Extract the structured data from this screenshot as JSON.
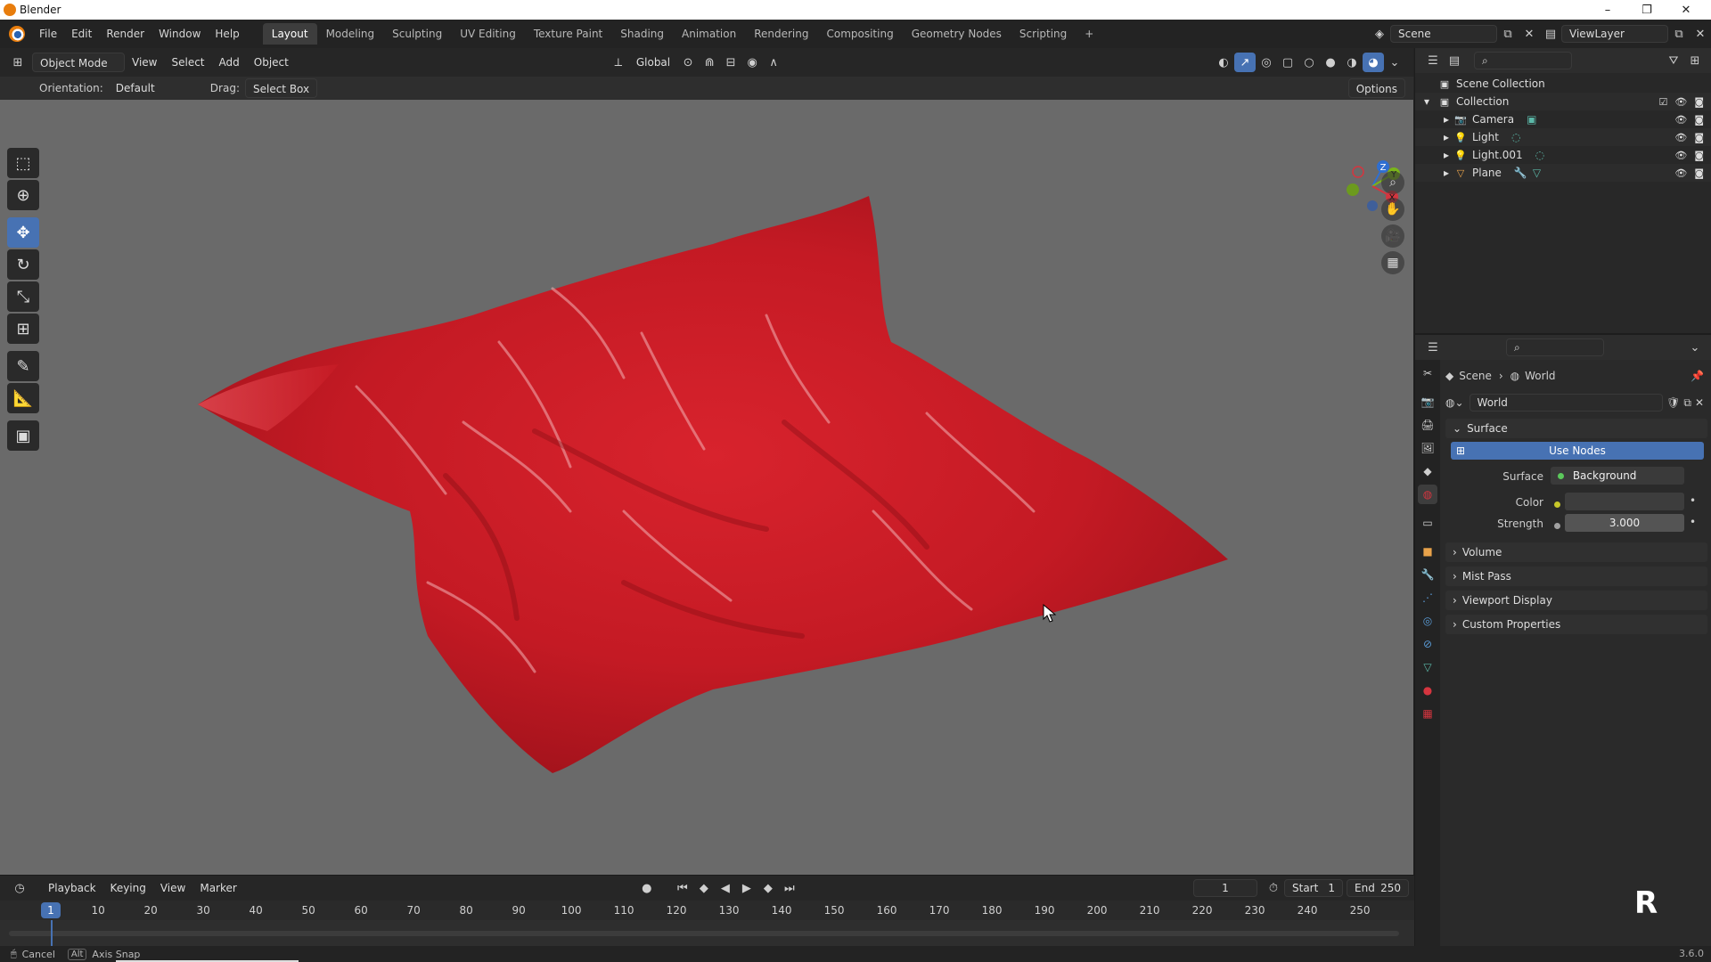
{
  "window": {
    "title": "Blender",
    "minimize": "–",
    "maximize": "❐",
    "close": "✕"
  },
  "menu": [
    "File",
    "Edit",
    "Render",
    "Window",
    "Help"
  ],
  "workspaces": [
    {
      "label": "Layout",
      "active": true
    },
    {
      "label": "Modeling"
    },
    {
      "label": "Sculpting"
    },
    {
      "label": "UV Editing"
    },
    {
      "label": "Texture Paint"
    },
    {
      "label": "Shading"
    },
    {
      "label": "Animation"
    },
    {
      "label": "Rendering"
    },
    {
      "label": "Compositing"
    },
    {
      "label": "Geometry Nodes"
    },
    {
      "label": "Scripting"
    },
    {
      "label": "+"
    }
  ],
  "scene_selector": {
    "value": "Scene"
  },
  "viewlayer_selector": {
    "value": "ViewLayer"
  },
  "viewport_header": {
    "mode": "Object Mode",
    "menus": [
      "View",
      "Select",
      "Add",
      "Object"
    ],
    "transform_orientation": "Global"
  },
  "tool_header": {
    "orientation_label": "Orientation:",
    "orientation_value": "Default",
    "drag_label": "Drag:",
    "drag_value": "Select Box",
    "options": "Options"
  },
  "gizmo": {
    "z": "Z",
    "y": "Y",
    "x": "X"
  },
  "outliner": {
    "root": "Scene Collection",
    "collection": "Collection",
    "items": [
      "Camera",
      "Light",
      "Light.001",
      "Plane"
    ]
  },
  "properties": {
    "breadcrumb": [
      "Scene",
      "World"
    ],
    "world_name": "World",
    "surface_panel": "Surface",
    "use_nodes": "Use Nodes",
    "surface_label": "Surface",
    "surface_value": "Background",
    "color_label": "Color",
    "strength_label": "Strength",
    "strength_value": "3.000",
    "collapsed_panels": [
      "Volume",
      "Mist Pass",
      "Viewport Display",
      "Custom Properties"
    ]
  },
  "timeline": {
    "menus": [
      "Playback",
      "Keying",
      "View",
      "Marker"
    ],
    "current_frame": "1",
    "start_label": "Start",
    "start_value": "1",
    "end_label": "End",
    "end_value": "250",
    "ruler": [
      "1",
      "10",
      "20",
      "30",
      "40",
      "50",
      "60",
      "70",
      "80",
      "90",
      "100",
      "110",
      "120",
      "130",
      "140",
      "150",
      "160",
      "170",
      "180",
      "190",
      "200",
      "210",
      "220",
      "230",
      "240",
      "250"
    ]
  },
  "statusbar": {
    "cancel": "Cancel",
    "alt_key": "Alt",
    "axis_snap": "Axis Snap",
    "version": "3.6.0"
  },
  "watermark": "R",
  "colors": {
    "accent": "#4772b3",
    "cloth": "#c81b25",
    "viewport_bg": "#6a6a6a"
  }
}
